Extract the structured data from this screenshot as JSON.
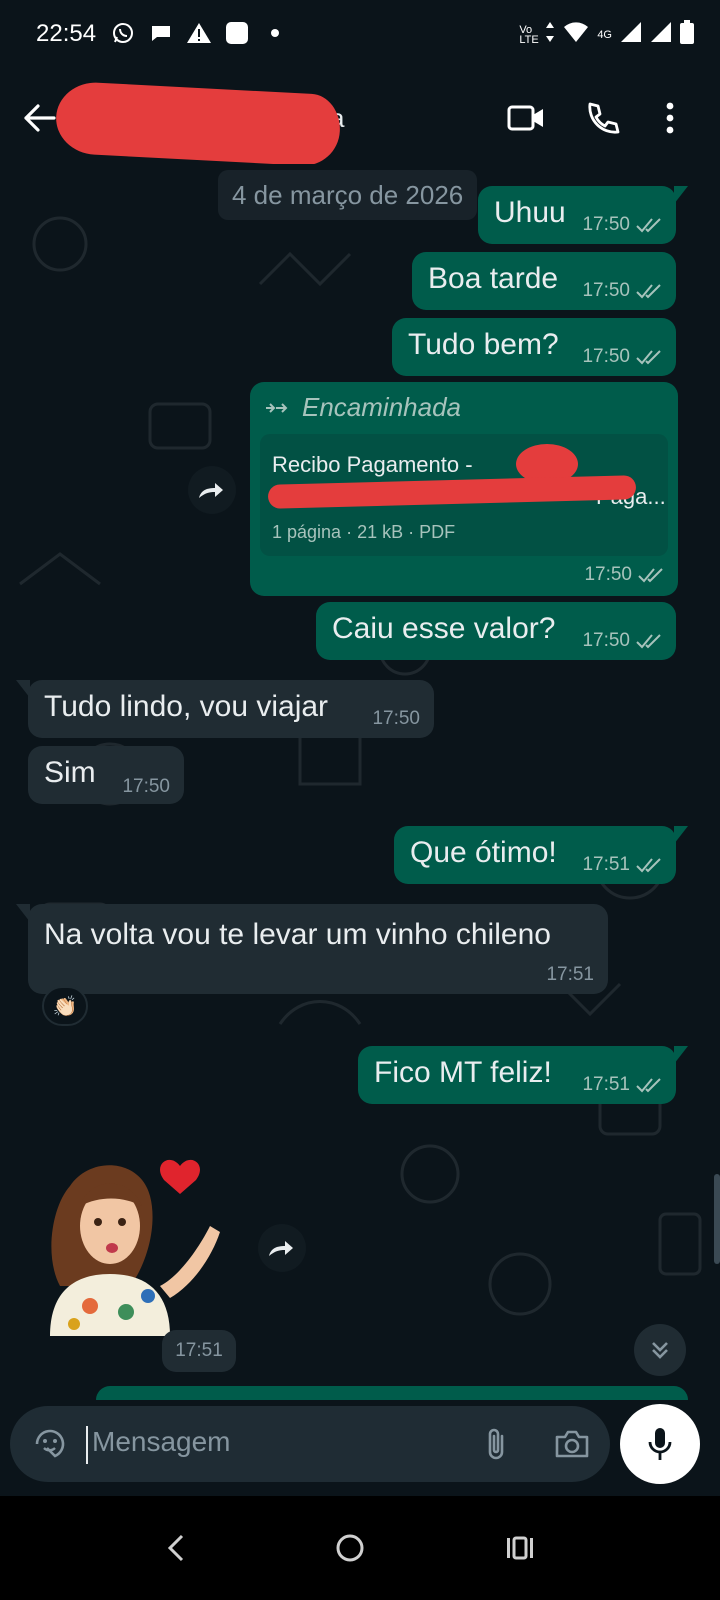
{
  "status_bar": {
    "time": "22:54",
    "left_icons": [
      "whatsapp-icon",
      "chat-bubble-icon",
      "warning-icon",
      "app-square-icon",
      "dot-icon"
    ],
    "right_icons": [
      "volte-icon",
      "data-arrows-icon",
      "wifi-icon",
      "4g-signal-icon",
      "signal-icon",
      "battery-icon"
    ],
    "volte_label": "Vo LTE",
    "network_label": "4G"
  },
  "header": {
    "contact_name_visible_suffix": "a",
    "contact_name_redacted": true,
    "actions": [
      "video-call-icon",
      "voice-call-icon",
      "more-options-icon"
    ]
  },
  "chat": {
    "date_chip": "4 de março de 2026",
    "messages": [
      {
        "dir": "out",
        "text": "Uhuu",
        "time": "17:50",
        "status": "read"
      },
      {
        "dir": "out",
        "text": "Boa tarde",
        "time": "17:50",
        "status": "read"
      },
      {
        "dir": "out",
        "text": "Tudo bem?",
        "time": "17:50",
        "status": "read"
      },
      {
        "dir": "out",
        "type": "document",
        "forwarded_label": "Encaminhada",
        "doc_title": "Recibo Pagamento - ",
        "doc_line2_suffix": "Paga...",
        "doc_pages": "1 página",
        "doc_size": "21 kB",
        "doc_type": "PDF",
        "time": "17:50",
        "status": "read"
      },
      {
        "dir": "out",
        "text": "Caiu esse valor?",
        "time": "17:50",
        "status": "read"
      },
      {
        "dir": "in",
        "text": "Tudo lindo, vou viajar",
        "time": "17:50"
      },
      {
        "dir": "in",
        "text": "Sim",
        "time": "17:50"
      },
      {
        "dir": "out",
        "text": "Que ótimo!",
        "time": "17:51",
        "status": "read"
      },
      {
        "dir": "in",
        "text": "Na volta vou te levar um vinho chileno",
        "time": "17:51",
        "reaction": "👏🏻"
      },
      {
        "dir": "out",
        "text": "Fico MT feliz!",
        "time": "17:51",
        "status": "read"
      },
      {
        "dir": "in",
        "type": "sticker",
        "time": "17:51"
      }
    ]
  },
  "input": {
    "placeholder": "Mensagem",
    "buttons": [
      "emoji-icon",
      "attach-icon",
      "camera-icon",
      "mic-icon"
    ]
  },
  "nav": [
    "back-nav-icon",
    "home-nav-icon",
    "recents-nav-icon"
  ],
  "colors": {
    "background": "#0b141a",
    "outgoing": "#005c4b",
    "incoming": "#202c33",
    "read_ticks": "#a7c3bc",
    "redaction": "#e43d3d"
  }
}
